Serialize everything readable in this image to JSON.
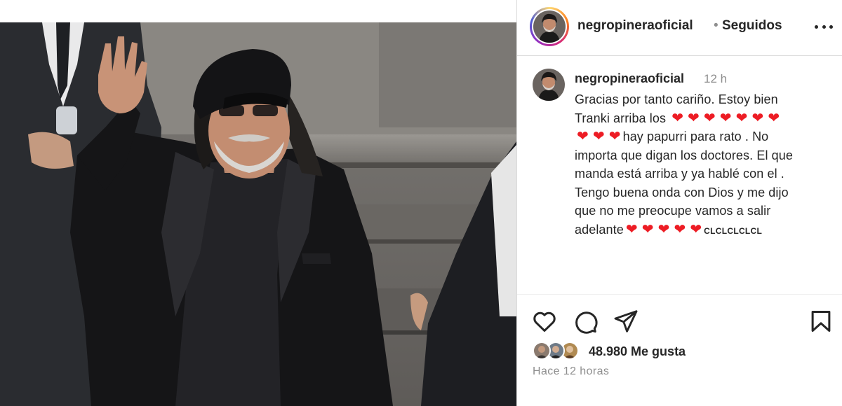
{
  "post": {
    "image_alt": "photo-of-man-waving",
    "header": {
      "username": "negropineraoficial",
      "separator": "•",
      "follow_status": "Seguidos"
    },
    "caption": {
      "username": "negropineraoficial",
      "time": "12 h",
      "line1": "Gracias por tanto cariño. Estoy bien",
      "line2": "Tranki arriba los",
      "line3": "hay papurri para rato . No",
      "line4": "importa que digan los doctores. El que",
      "line5": "manda está arriba y ya hablé con el .",
      "line6": "Tengo buena onda con Dios y me dijo",
      "line7": "que no me preocupe vamos a salir",
      "line8": "adelante",
      "suffix": "CLCLCLCLCL",
      "heart_glyph": "❤"
    },
    "actions": {
      "like_icon": "heart-outline-icon",
      "comment_icon": "comment-bubble-icon",
      "share_icon": "paper-plane-icon",
      "save_icon": "bookmark-icon"
    },
    "likes_text": "48.980 Me gusta",
    "posted_ago": "Hace 12 horas"
  },
  "colors": {
    "heart": "#ed1c24",
    "text": "#262626",
    "muted": "#8e8e8e",
    "border": "#dbdbdb"
  }
}
